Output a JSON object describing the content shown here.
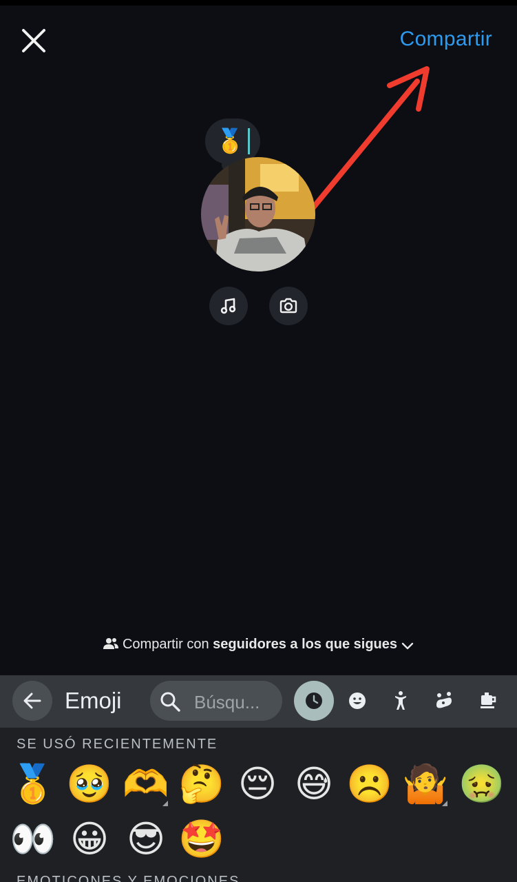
{
  "header": {
    "share_label": "Compartir"
  },
  "note": {
    "emoji": "🥇"
  },
  "audience": {
    "prefix": "Compartir con",
    "target": "seguidores a los que sigues"
  },
  "keyboard": {
    "title": "Emoji",
    "search_placeholder": "Búsqu...",
    "active_category": "recent",
    "categories": [
      "clock-icon",
      "smiley-icon",
      "person-icon",
      "animal-icon",
      "food-icon"
    ],
    "recent_section_label": "SE USÓ RECIENTEMENTE",
    "emotions_section_label": "EMOTICONES Y EMOCIONES",
    "recent_emojis": [
      "🥇",
      "🥹",
      "🫶",
      "🤔",
      "😔",
      "😅",
      "☹️",
      "🤷",
      "🤢",
      "👀",
      "😀",
      "😎",
      "🤩"
    ]
  },
  "colors": {
    "background": "#0c0e14",
    "accent": "#2d9bf0",
    "annotation_arrow": "#f03c2e",
    "keyboard_bar": "#35393d",
    "keyboard_body": "#1e2024"
  }
}
